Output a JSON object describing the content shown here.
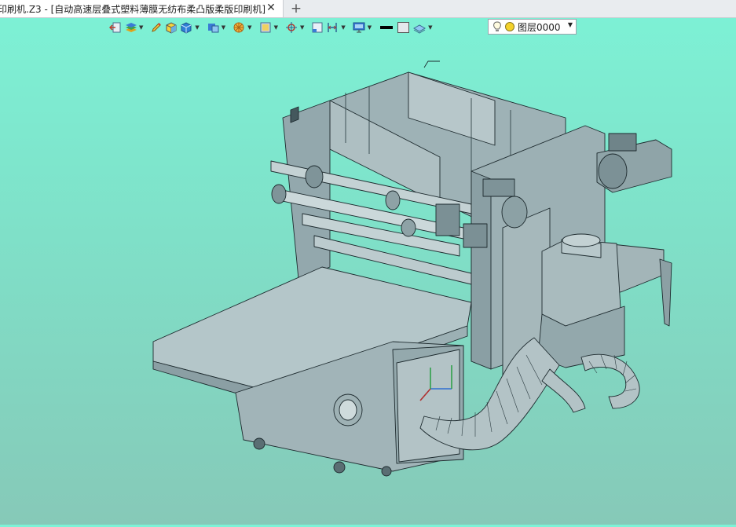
{
  "tab": {
    "title": "印刷机.Z3 - [自动高速层叠式塑料薄膜无纺布柔凸版柔版印刷机]",
    "close_glyph": "✕",
    "add_glyph": "+"
  },
  "toolbar": {
    "icons": [
      "exit-icon",
      "layers-icon",
      "pencil-icon",
      "cube-shaded-icon",
      "cube-blue-icon",
      "cube-display-icon",
      "render-icon",
      "display-mode-icon",
      "snap-icon",
      "view-frame-icon",
      "dimension-icon",
      "monitor-icon",
      "line-color-swatch",
      "fill-color-swatch",
      "surface-icon"
    ]
  },
  "layer": {
    "name": "图层0000",
    "light_icon": "bulb-icon",
    "color_icon": "yellow-circle-icon"
  },
  "colors": {
    "background_top": "#7df2d6",
    "background_bottom": "#86c9b8",
    "machine_fill": "#9fb3b7",
    "machine_edge": "#1d2a2e"
  }
}
